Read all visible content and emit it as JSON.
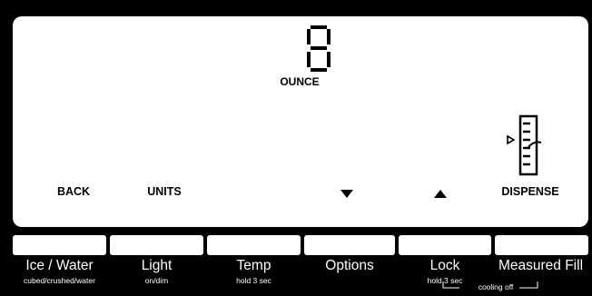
{
  "display": {
    "digit": "8",
    "unit": "OUNCE",
    "meter_level": 0.5
  },
  "softkeys": {
    "back": "BACK",
    "units": "UNITS",
    "down_icon": "triangle-down-icon",
    "up_icon": "triangle-up-icon",
    "dispense": "DISPENSE"
  },
  "buttons": [
    {
      "label": "Ice / Water",
      "sub": "cubed/crushed/water"
    },
    {
      "label": "Light",
      "sub": "on/dim"
    },
    {
      "label": "Temp",
      "sub": "hold 3 sec"
    },
    {
      "label": "Options",
      "sub": ""
    },
    {
      "label": "Lock",
      "sub": "hold 3 sec"
    },
    {
      "label": "Measured Fill",
      "sub": ""
    }
  ],
  "cooling_off": "cooling off",
  "colors": {
    "background": "#000000",
    "screen": "#ffffff",
    "text": "#ffffff"
  }
}
